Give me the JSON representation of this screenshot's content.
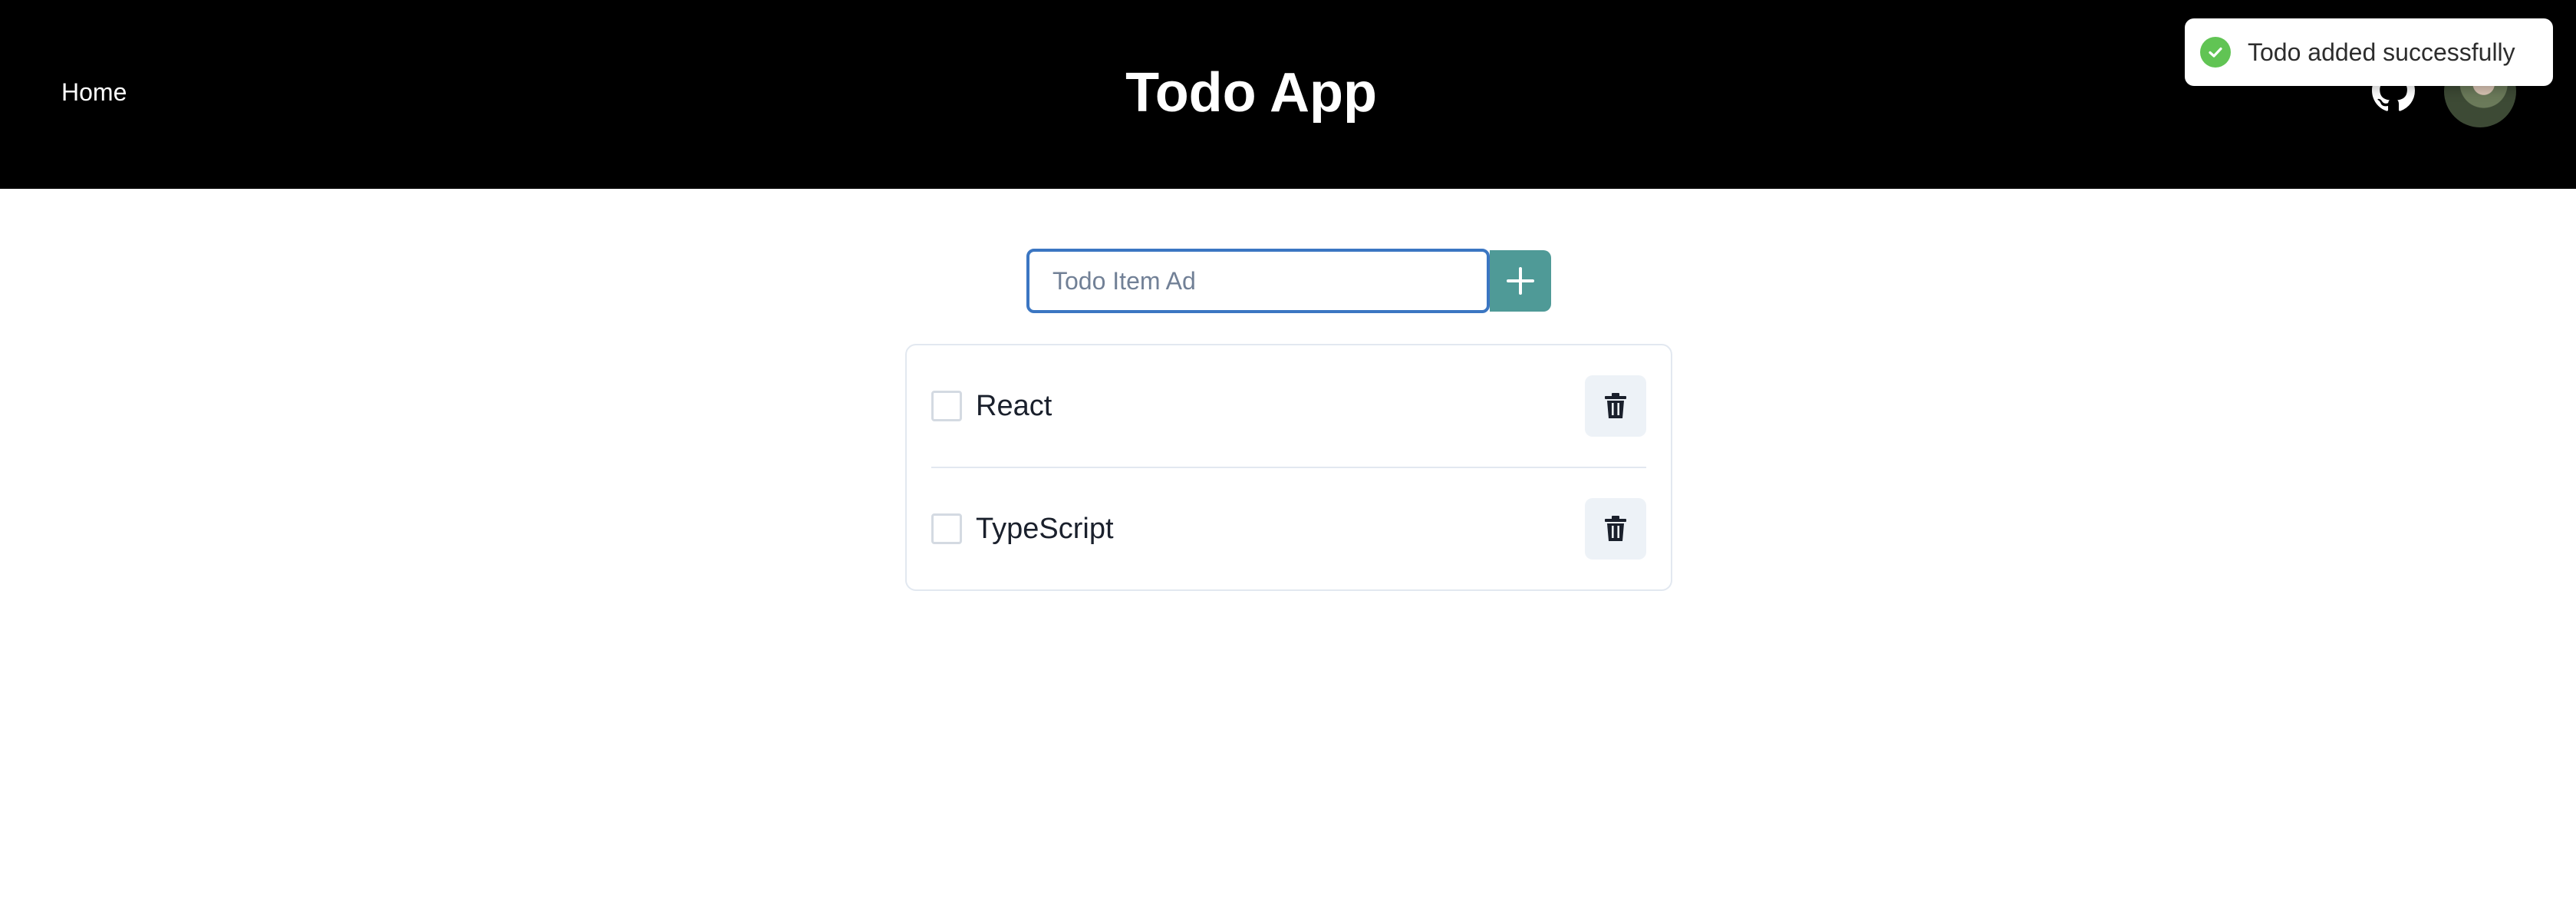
{
  "nav": {
    "home_label": "Home"
  },
  "header": {
    "title": "Todo App",
    "icons": [
      "github-icon",
      "avatar"
    ]
  },
  "toast": {
    "message": "Todo added successfully",
    "icon": "check-circle-icon",
    "status_color": "#61c454"
  },
  "add_form": {
    "placeholder": "Todo Item Ad",
    "value": "",
    "add_icon": "plus-icon",
    "button_color": "#4f9a97"
  },
  "todos": [
    {
      "label": "React",
      "done": false,
      "delete_icon": "trash-icon"
    },
    {
      "label": "TypeScript",
      "done": false,
      "delete_icon": "trash-icon"
    }
  ]
}
